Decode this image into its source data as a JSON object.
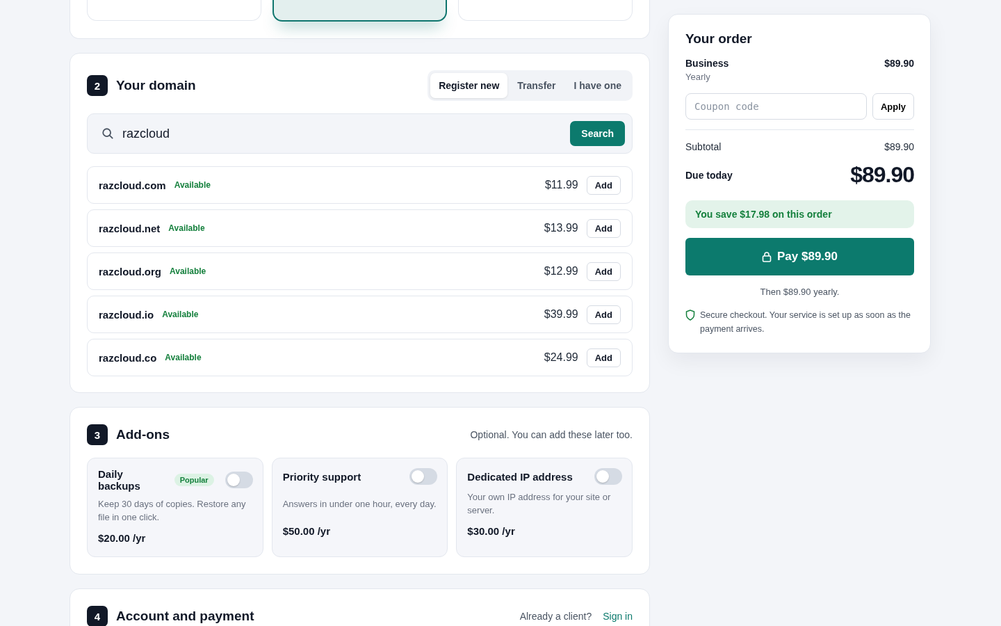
{
  "plans": [
    {
      "selected": false
    },
    {
      "selected": true
    },
    {
      "selected": false
    }
  ],
  "domain": {
    "step": "2",
    "title": "Your domain",
    "tabs": [
      {
        "label": "Register new",
        "selected": true
      },
      {
        "label": "Transfer",
        "selected": false
      },
      {
        "label": "I have one",
        "selected": false
      }
    ],
    "search": {
      "value": "razcloud",
      "button": "Search"
    },
    "results": [
      {
        "name": "razcloud.com",
        "status": "Available",
        "price": "$11.99",
        "action": "Add"
      },
      {
        "name": "razcloud.net",
        "status": "Available",
        "price": "$13.99",
        "action": "Add"
      },
      {
        "name": "razcloud.org",
        "status": "Available",
        "price": "$12.99",
        "action": "Add"
      },
      {
        "name": "razcloud.io",
        "status": "Available",
        "price": "$39.99",
        "action": "Add"
      },
      {
        "name": "razcloud.co",
        "status": "Available",
        "price": "$24.99",
        "action": "Add"
      }
    ]
  },
  "addons": {
    "step": "3",
    "title": "Add-ons",
    "note": "Optional. You can add these later too.",
    "items": [
      {
        "name": "Daily backups",
        "badge": "Popular",
        "on": false,
        "description": "Keep 30 days of copies. Restore any file in one click.",
        "price": "$20.00 /yr"
      },
      {
        "name": "Priority support",
        "on": false,
        "description": "Answers in under one hour, every day.",
        "price": "$50.00 /yr"
      },
      {
        "name": "Dedicated IP address",
        "on": false,
        "description": "Your own IP address for your site or server.",
        "price": "$30.00 /yr"
      }
    ]
  },
  "account": {
    "step": "4",
    "title": "Account and payment",
    "prompt": "Already a client?",
    "link": "Sign in"
  },
  "order": {
    "title": "Your order",
    "plan": "Business",
    "plan_price": "$89.90",
    "period": "Yearly",
    "coupon": {
      "placeholder": "Coupon code",
      "button": "Apply"
    },
    "subtotal_label": "Subtotal",
    "subtotal": "$89.90",
    "due_label": "Due today",
    "due": "$89.90",
    "savings": "You save $17.98 on this order",
    "pay_button": "Pay $89.90",
    "then": "Then $89.90 yearly.",
    "secure_note": "Secure checkout. Your service is set up as soon as the payment arrives."
  }
}
